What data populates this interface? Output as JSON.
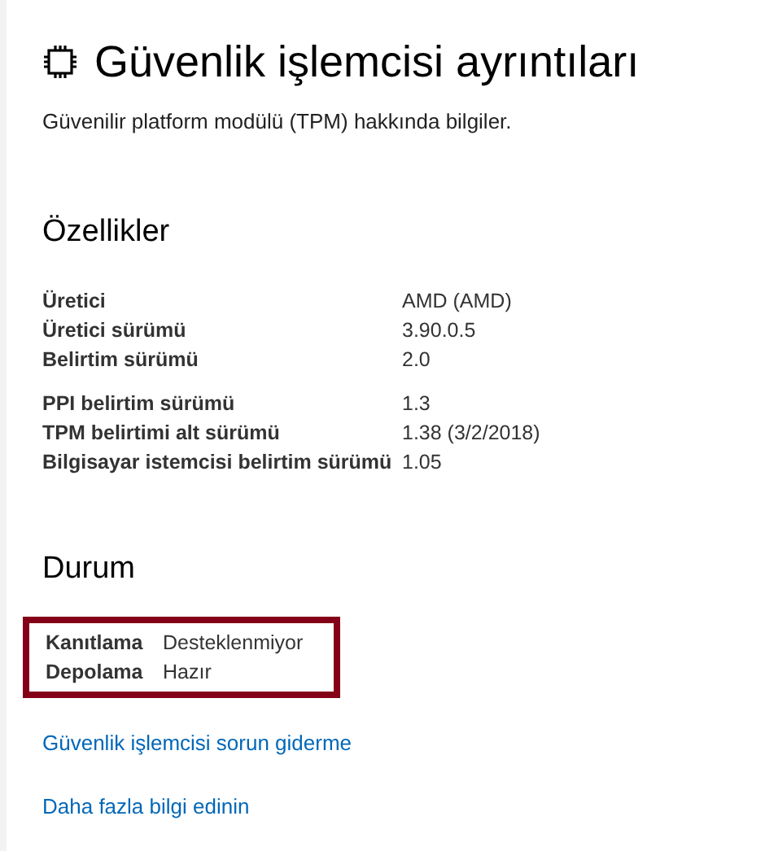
{
  "header": {
    "title": "Güvenlik işlemcisi ayrıntıları",
    "subtitle": "Güvenilir platform modülü (TPM) hakkında bilgiler."
  },
  "properties": {
    "heading": "Özellikler",
    "groups": [
      [
        {
          "label": "Üretici",
          "value": "AMD (AMD)"
        },
        {
          "label": "Üretici sürümü",
          "value": "3.90.0.5"
        },
        {
          "label": "Belirtim sürümü",
          "value": "2.0"
        }
      ],
      [
        {
          "label": "PPI belirtim sürümü",
          "value": "1.3"
        },
        {
          "label": "TPM belirtimi alt sürümü",
          "value": "1.38 (3/2/2018)"
        },
        {
          "label": "Bilgisayar istemcisi belirtim sürümü",
          "value": "1.05"
        }
      ]
    ]
  },
  "status": {
    "heading": "Durum",
    "highlighted": true,
    "rows": [
      {
        "label": "Kanıtlama",
        "value": "Desteklenmiyor"
      },
      {
        "label": "Depolama",
        "value": "Hazır"
      }
    ]
  },
  "links": [
    "Güvenlik işlemcisi sorun giderme",
    "Daha fazla bilgi edinin"
  ]
}
